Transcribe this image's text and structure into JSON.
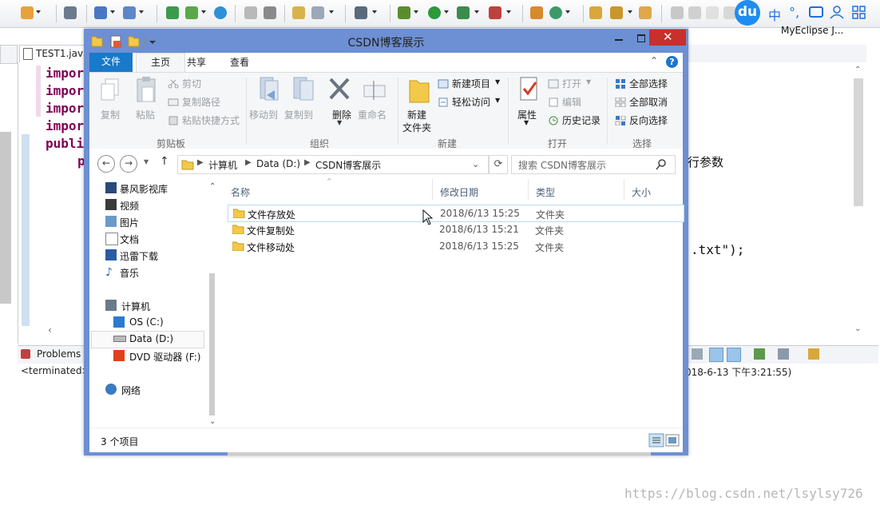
{
  "eclipse": {
    "perspective_label": "MyEclipse J...",
    "ime_chars": [
      "中",
      "°,"
    ],
    "baidu_logo": "du",
    "editor_tab": "TEST1.java",
    "code_lines": [
      "impor",
      "impor",
      "impor",
      "impor",
      "publi",
      "p"
    ],
    "code_fragment_1": "行参数",
    "code_fragment_2": ".txt\");",
    "console_tab": "Problems",
    "console_terminated": "<terminated>",
    "console_time": "018-6-13 下午3:21:55)"
  },
  "window": {
    "title": "CSDN博客展示",
    "ribbon_tabs": [
      "文件",
      "主页",
      "共享",
      "查看"
    ],
    "clipboard": {
      "title": "剪贴板",
      "copy": "复制",
      "paste": "粘贴",
      "cut": "剪切",
      "copy_path": "复制路径",
      "paste_shortcut": "粘贴快捷方式"
    },
    "organize": {
      "title": "组织",
      "move_to": "移动到",
      "copy_to": "复制到",
      "delete": "删除",
      "rename": "重命名"
    },
    "new": {
      "title": "新建",
      "new_item": "新建项目",
      "easy_access": "轻松访问",
      "new_folder_1": "新建",
      "new_folder_2": "文件夹"
    },
    "open": {
      "title": "打开",
      "properties": "属性",
      "open": "打开",
      "edit": "编辑",
      "history": "历史记录"
    },
    "select": {
      "title": "选择",
      "select_all": "全部选择",
      "select_none": "全部取消",
      "invert": "反向选择"
    },
    "breadcrumb": [
      "计算机",
      "Data (D:)",
      "CSDN博客展示"
    ],
    "search_placeholder": "搜索 CSDN博客展示",
    "nav": {
      "favorites": [
        "暴风影视库",
        "视频",
        "图片",
        "文档",
        "迅雷下载",
        "音乐"
      ],
      "computer": "计算机",
      "drives": [
        "OS (C:)",
        "Data (D:)",
        "DVD 驱动器 (F:)"
      ],
      "network": "网络"
    },
    "columns": {
      "name": "名称",
      "modified": "修改日期",
      "type": "类型",
      "size": "大小"
    },
    "files": [
      {
        "name": "文件存放处",
        "modified": "2018/6/13 15:25",
        "type": "文件夹"
      },
      {
        "name": "文件复制处",
        "modified": "2018/6/13 15:21",
        "type": "文件夹"
      },
      {
        "name": "文件移动处",
        "modified": "2018/6/13 15:25",
        "type": "文件夹"
      }
    ],
    "status": "3 个项目"
  },
  "watermark": "https://blog.csdn.net/lsylsy726"
}
